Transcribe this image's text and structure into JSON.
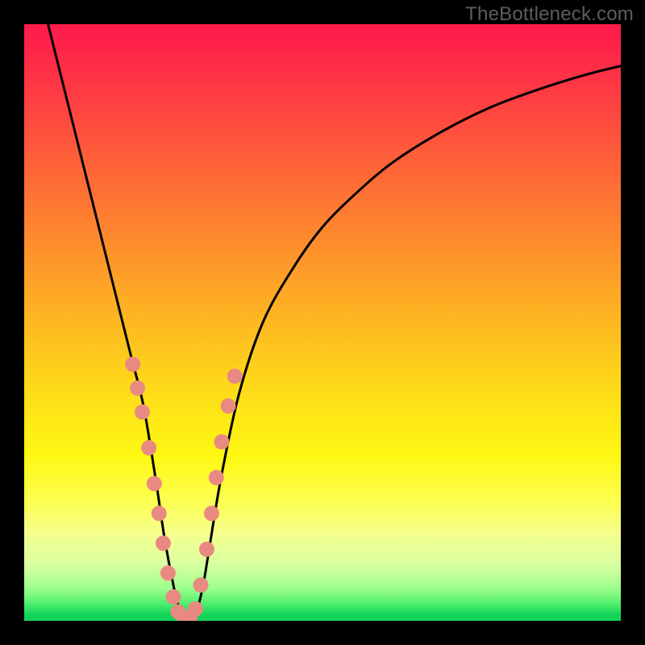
{
  "watermark": "TheBottleneck.com",
  "chart_data": {
    "type": "line",
    "title": "",
    "xlabel": "",
    "ylabel": "",
    "xlim": [
      0,
      100
    ],
    "ylim": [
      0,
      100
    ],
    "curve": {
      "note": "V-shaped bottleneck curve; minimum near x≈27; left branch steep, right branch gradual asymptote",
      "x": [
        4,
        6,
        8,
        10,
        12,
        14,
        16,
        18,
        20,
        22,
        23.5,
        25,
        26,
        27,
        28,
        29,
        30,
        31,
        33,
        36,
        40,
        45,
        50,
        56,
        62,
        70,
        78,
        86,
        94,
        100
      ],
      "y": [
        100,
        92,
        84,
        76,
        68,
        60,
        52,
        44,
        36,
        24,
        14,
        6,
        2,
        0.5,
        0.5,
        2,
        6,
        12,
        24,
        38,
        50,
        59,
        66,
        72,
        77,
        82,
        86,
        89,
        91.5,
        93
      ]
    },
    "dots": {
      "note": "salmon dots overlaid on both branches near the valley",
      "color": "#e98a82",
      "points": [
        {
          "x": 18.2,
          "y": 43
        },
        {
          "x": 19.0,
          "y": 39
        },
        {
          "x": 19.8,
          "y": 35
        },
        {
          "x": 20.9,
          "y": 29
        },
        {
          "x": 21.8,
          "y": 23
        },
        {
          "x": 22.6,
          "y": 18
        },
        {
          "x": 23.3,
          "y": 13
        },
        {
          "x": 24.1,
          "y": 8
        },
        {
          "x": 25.0,
          "y": 4
        },
        {
          "x": 25.8,
          "y": 1.5
        },
        {
          "x": 26.8,
          "y": 0.5
        },
        {
          "x": 27.8,
          "y": 0.6
        },
        {
          "x": 28.7,
          "y": 2
        },
        {
          "x": 29.6,
          "y": 6
        },
        {
          "x": 30.6,
          "y": 12
        },
        {
          "x": 31.4,
          "y": 18
        },
        {
          "x": 32.2,
          "y": 24
        },
        {
          "x": 33.1,
          "y": 30
        },
        {
          "x": 34.2,
          "y": 36
        },
        {
          "x": 35.3,
          "y": 41
        }
      ]
    },
    "gradient_bands": [
      {
        "from": 0.0,
        "color": "#fe1a4b"
      },
      {
        "from": 0.08,
        "color": "#fe3046"
      },
      {
        "from": 0.16,
        "color": "#fe4a3f"
      },
      {
        "from": 0.24,
        "color": "#fe6438"
      },
      {
        "from": 0.32,
        "color": "#fe7e31"
      },
      {
        "from": 0.4,
        "color": "#fe982a"
      },
      {
        "from": 0.48,
        "color": "#feb223"
      },
      {
        "from": 0.56,
        "color": "#fecb1d"
      },
      {
        "from": 0.64,
        "color": "#fee317"
      },
      {
        "from": 0.725,
        "color": "#fef813"
      },
      {
        "from": 0.805,
        "color": "#fcff56"
      },
      {
        "from": 0.856,
        "color": "#f5ff8f"
      },
      {
        "from": 0.907,
        "color": "#d7ffa0"
      },
      {
        "from": 0.945,
        "color": "#9fff8d"
      },
      {
        "from": 0.972,
        "color": "#4eee6e"
      },
      {
        "from": 0.99,
        "color": "#12d458"
      }
    ]
  }
}
